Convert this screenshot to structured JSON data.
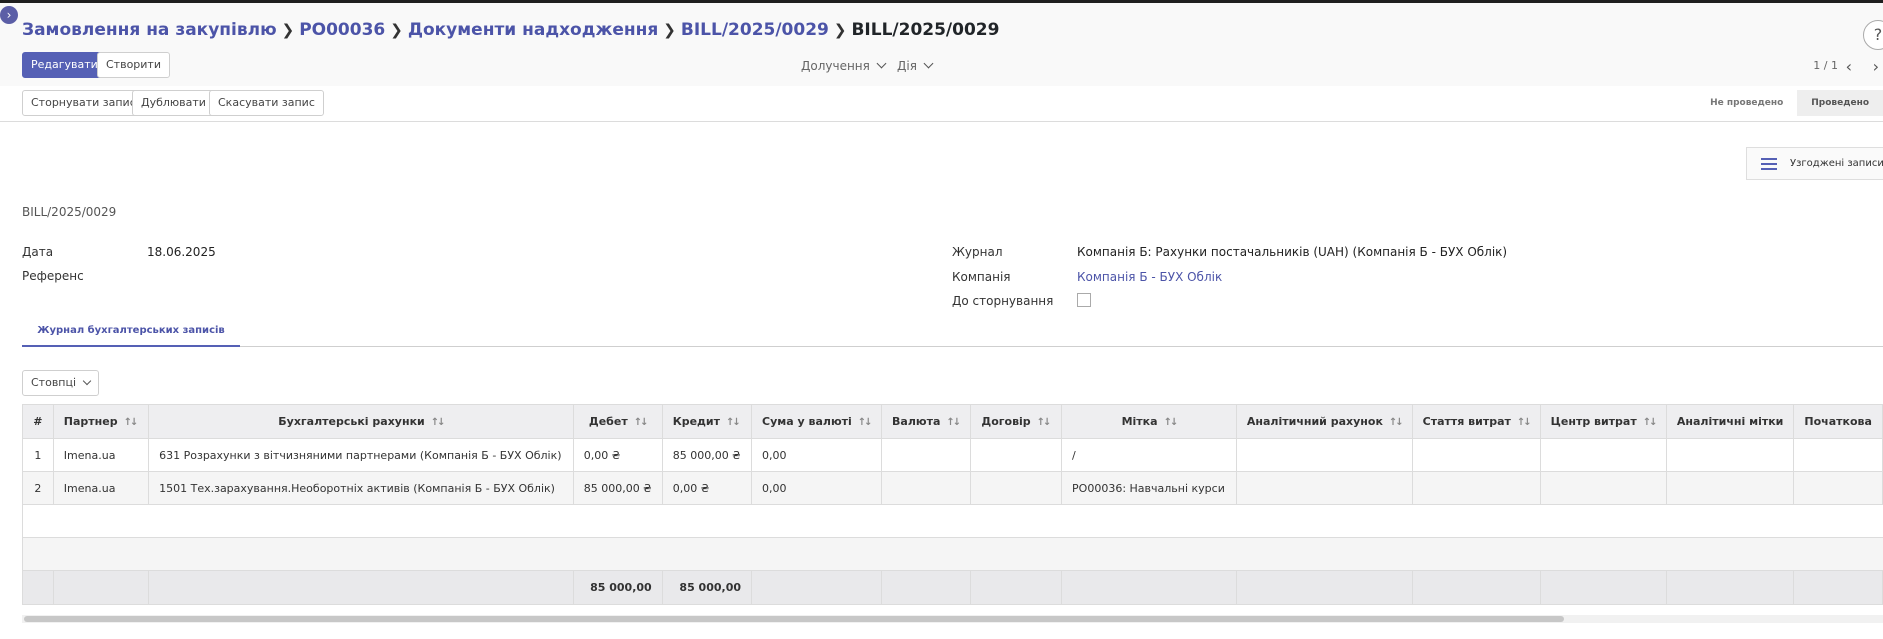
{
  "breadcrumb": {
    "items": [
      "Замовлення на закупівлю",
      "PO00036",
      "Документи надходження",
      "BILL/2025/0029"
    ],
    "current": "BILL/2025/0029"
  },
  "toolbar": {
    "edit": "Редагувати",
    "create": "Створити",
    "attachments": "Долучення",
    "action": "Дія",
    "pager": "1 / 1",
    "help": "?"
  },
  "header": {
    "reverse": "Сторнувати запис",
    "duplicate": "Дублювати",
    "cancel": "Скасувати запис",
    "states": [
      "Не проведено",
      "Проведено"
    ],
    "current_state": "Проведено"
  },
  "smart": {
    "reconciled": "Узгоджені записи"
  },
  "form": {
    "title": "BILL/2025/0029",
    "date_label": "Дата",
    "date": "18.06.2025",
    "ref_label": "Референс",
    "journal_label": "Журнал",
    "journal": "Компанія Б: Рахунки постачальників (UAH) (Компанія Б - БУХ Облік)",
    "company_label": "Компанія",
    "company": "Компанія Б - БУХ Облік",
    "reverse_label": "До сторнування"
  },
  "tabs": {
    "active": "Журнал бухгалтерських записів"
  },
  "columns_btn": "Стовпці",
  "table": {
    "headers": [
      "#",
      "Партнер",
      "Бухгалтерські рахунки",
      "Дебет",
      "Кредит",
      "Сума у валюті",
      "Валюта",
      "Договір",
      "Мітка",
      "Аналітичний рахунок",
      "Стаття витрат",
      "Центр витрат",
      "Аналітичні мітки",
      "Початкова"
    ],
    "rows": [
      [
        "1",
        "Imena.ua",
        "631 Розрахунки з вітчизняними партнерами (Компанія Б - БУХ Облік)",
        "0,00 ₴",
        "85 000,00 ₴",
        "0,00",
        "",
        "",
        "/",
        "",
        "",
        "",
        "",
        ""
      ],
      [
        "2",
        "Imena.ua",
        "1501 Тех.зарахування.Необоротніх активів (Компанія Б - БУХ Облік)",
        "85 000,00 ₴",
        "0,00 ₴",
        "0,00",
        "",
        "",
        "PO00036: Навчальні курси",
        "",
        "",
        "",
        "",
        ""
      ]
    ],
    "totals": {
      "debit": "85 000,00",
      "credit": "85 000,00"
    }
  },
  "colors": {
    "accent": "#5560b5",
    "link": "#4c54a8"
  }
}
